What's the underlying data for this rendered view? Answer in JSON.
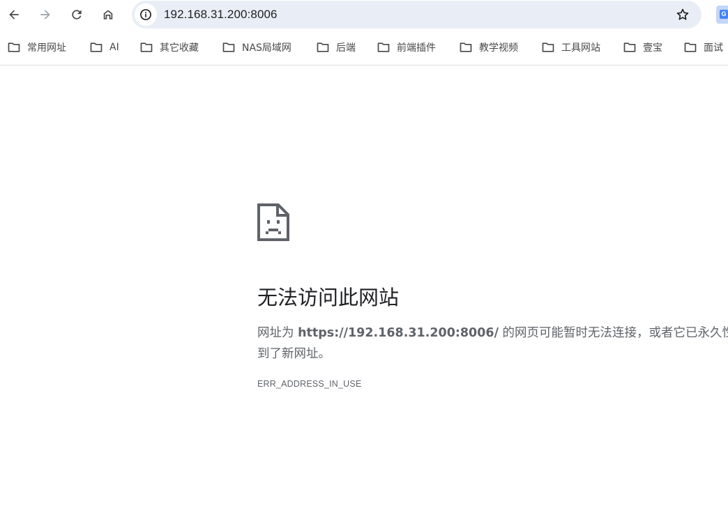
{
  "toolbar": {
    "back_icon": "arrow-left-icon",
    "forward_icon": "arrow-right-icon",
    "reload_icon": "reload-icon",
    "home_icon": "home-icon",
    "site_info_icon": "info-icon",
    "url": "192.168.31.200:8006",
    "bookmark_star_icon": "star-icon",
    "extension_icon": "google-translate-icon",
    "extension_letter": "G"
  },
  "bookmarks": [
    {
      "label": "常用网址",
      "icon": "folder-icon"
    },
    {
      "label": "AI",
      "icon": "folder-icon"
    },
    {
      "label": "其它收藏",
      "icon": "folder-icon"
    },
    {
      "label": "NAS局域网",
      "icon": "folder-icon"
    },
    {
      "label": "后端",
      "icon": "folder-icon"
    },
    {
      "label": "前端插件",
      "icon": "folder-icon"
    },
    {
      "label": "教学视频",
      "icon": "folder-icon"
    },
    {
      "label": "工具网站",
      "icon": "folder-icon"
    },
    {
      "label": "壹宝",
      "icon": "folder-icon"
    },
    {
      "label": "面试",
      "icon": "folder-icon"
    }
  ],
  "error": {
    "icon": "sad-page-icon",
    "title": "无法访问此网站",
    "desc_prefix": "网址为 ",
    "desc_url": "https://192.168.31.200:8006/",
    "desc_suffix": " 的网页可能暂时无法连接，或者它已永久性地移动",
    "desc_line2": "到了新网址。",
    "code": "ERR_ADDRESS_IN_USE"
  },
  "colors": {
    "omnibox_bg": "#e9eef6",
    "text_primary": "#202124",
    "text_secondary": "#5f6368",
    "icon_gray": "#474747"
  }
}
